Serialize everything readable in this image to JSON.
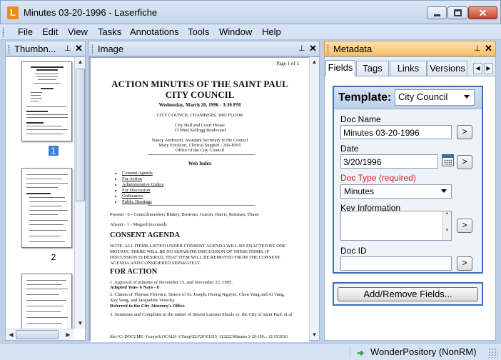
{
  "window": {
    "title": "Minutes 03-20-1996 - Laserfiche",
    "app_icon": "L",
    "close_glyph": "✕"
  },
  "menu": [
    "File",
    "Edit",
    "View",
    "Tasks",
    "Annotations",
    "Tools",
    "Window",
    "Help"
  ],
  "panes": {
    "thumbnails": {
      "title": "Thumbn...",
      "pages": [
        "1",
        "2"
      ]
    },
    "image": {
      "title": "Image"
    },
    "metadata": {
      "title": "Metadata"
    },
    "pin_glyph": "⊥",
    "close_glyph": "✕"
  },
  "document": {
    "page_label": "Page 1 of 5",
    "title_line1": "ACTION MINUTES OF THE SAINT PAUL",
    "title_line2": "CITY COUNCIL",
    "date_line": "Wednesday, March 20, 1996 - 3:30 PM",
    "chambers": "CITY COUNCIL CHAMBERS, 3RD FLOOR",
    "address1": "City Hall and Court House",
    "address2": "15 West Kellogg Boulevard",
    "staff1": "Nancy Anderson, Assistant Secretary to the Council",
    "staff2": "Mary Erickson, Clerical Support - 266-8565",
    "staff3": "Office of the City Council",
    "web_index_title": "Web Index",
    "web_index": [
      "Consent Agenda",
      "For Action",
      "Administrative Orders",
      "For Discussion",
      "Ordinances",
      "Public Hearings"
    ],
    "present": "Present - 6 - Councilmembers Blakey, Bostrom, Guerin, Harris, Rettman, Thune",
    "absent": "Absent - 1 - Megard (excused)",
    "consent_heading": "CONSENT AGENDA",
    "consent_note": "NOTE: ALL ITEMS LISTED UNDER CONSENT AGENDA WILL BE ENACTED BY ONE MOTION. THERE WILL BE NO SEPARATE DISCUSSION OF THESE ITEMS. IF DISCUSSION IS DESIRED, THAT ITEM WILL BE REMOVED FROM THE CONSENT AGENDA AND CONSIDERED SEPARATELY.",
    "action_heading": "FOR ACTION",
    "item1": "1. Approval of minutes of November 15, and November 22, 1995.",
    "item1_result": "Adopted Yeas- 6 Nays - 0",
    "item2": "2. Claims of Thomas Florence, Sisters of St. Joseph, Huong Nguyen, Chon Yang and Ai Vang, Xay Vang, and Jacqueline Vesecky.",
    "item2_result": "Referred to the City Attorney's Office",
    "item3": "3. Summons and Complaint in the matter of Steven Lamont Shoals vs. the City of Saint Paul, et al.",
    "footer": "file://C:\\DOCUME~1\\cayre\\LOCALS~1\\Temp\\ELF20101215_113222\\Minutes 3-20-199...     12/15/2010"
  },
  "metadata": {
    "tabs": [
      "Fields",
      "Tags",
      "Links",
      "Versions"
    ],
    "active_tab": "Fields",
    "template_label": "Template:",
    "template_value": "City Council",
    "fields": {
      "doc_name_label": "Doc Name",
      "doc_name_value": "Minutes 03-20-1996",
      "date_label": "Date",
      "date_value": "3/20/1996",
      "doc_type_label": "Doc Type (required)",
      "doc_type_value": "Minutes",
      "key_info_label": "Key Information",
      "key_info_value": "",
      "doc_id_label": "Doc ID",
      "doc_id_value": ""
    },
    "go_glyph": ">",
    "add_remove_label": "Add/Remove Fields..."
  },
  "status": {
    "repository": "WonderPository (NonRM)",
    "repository_icon": "connected-arrow-icon"
  },
  "colors": {
    "active_pane": "#f8bf66",
    "template_border": "#3c6fb4",
    "required_label": "#d01c1c",
    "selected_thumb": "#3a80d6"
  }
}
